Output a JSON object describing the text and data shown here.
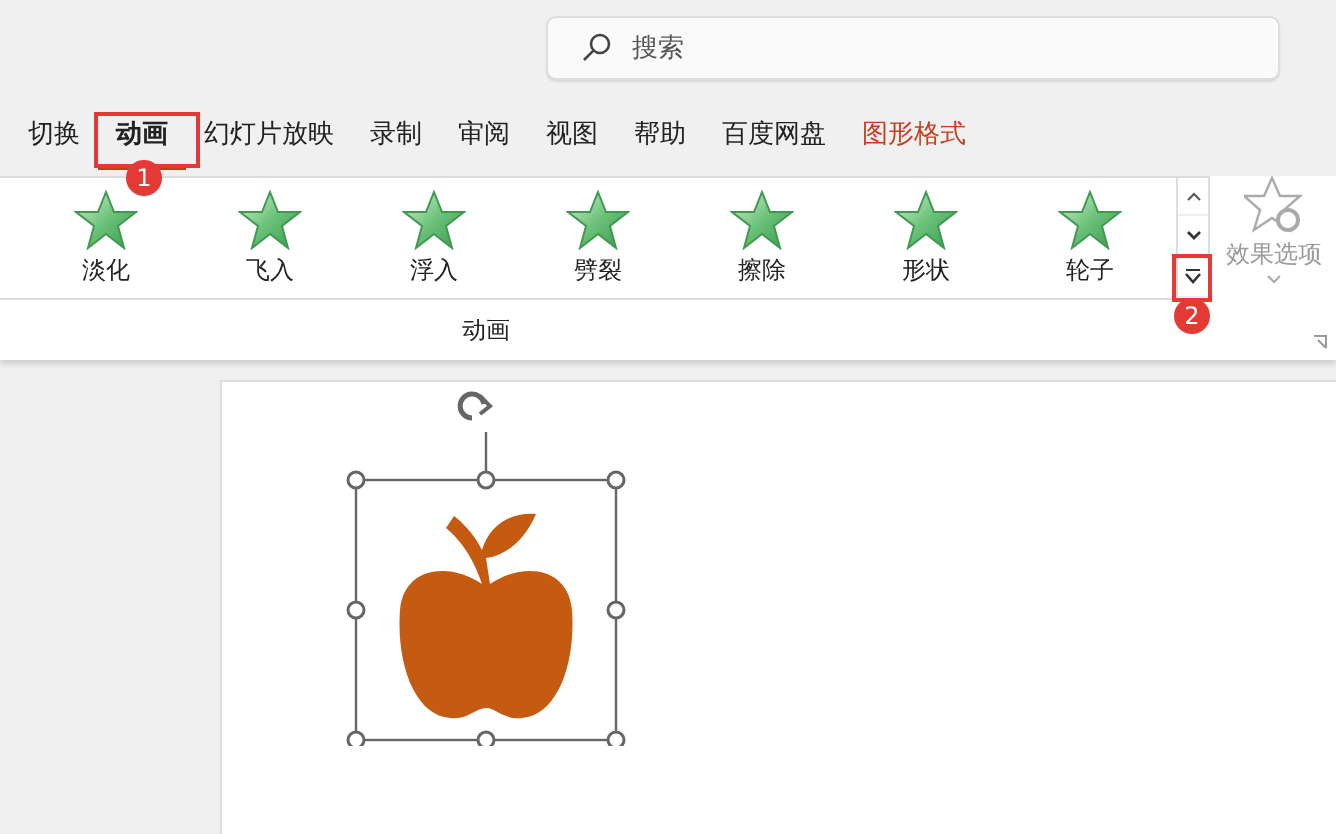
{
  "search": {
    "placeholder": "搜索"
  },
  "tabs": [
    {
      "label": "切换",
      "selected": false,
      "kind": "normal"
    },
    {
      "label": "动画",
      "selected": true,
      "kind": "normal"
    },
    {
      "label": "幻灯片放映",
      "selected": false,
      "kind": "normal"
    },
    {
      "label": "录制",
      "selected": false,
      "kind": "normal"
    },
    {
      "label": "审阅",
      "selected": false,
      "kind": "normal"
    },
    {
      "label": "视图",
      "selected": false,
      "kind": "normal"
    },
    {
      "label": "帮助",
      "selected": false,
      "kind": "normal"
    },
    {
      "label": "百度网盘",
      "selected": false,
      "kind": "normal"
    },
    {
      "label": "图形格式",
      "selected": false,
      "kind": "contextual"
    }
  ],
  "animation_gallery": {
    "items": [
      {
        "label": "淡化"
      },
      {
        "label": "飞入"
      },
      {
        "label": "浮入"
      },
      {
        "label": "劈裂"
      },
      {
        "label": "擦除"
      },
      {
        "label": "形状"
      },
      {
        "label": "轮子"
      }
    ],
    "group_label": "动画"
  },
  "effect_options": {
    "label": "效果选项",
    "disabled": true
  },
  "annotations": [
    {
      "label": "1",
      "kind": "tab"
    },
    {
      "label": "2",
      "kind": "more"
    }
  ]
}
